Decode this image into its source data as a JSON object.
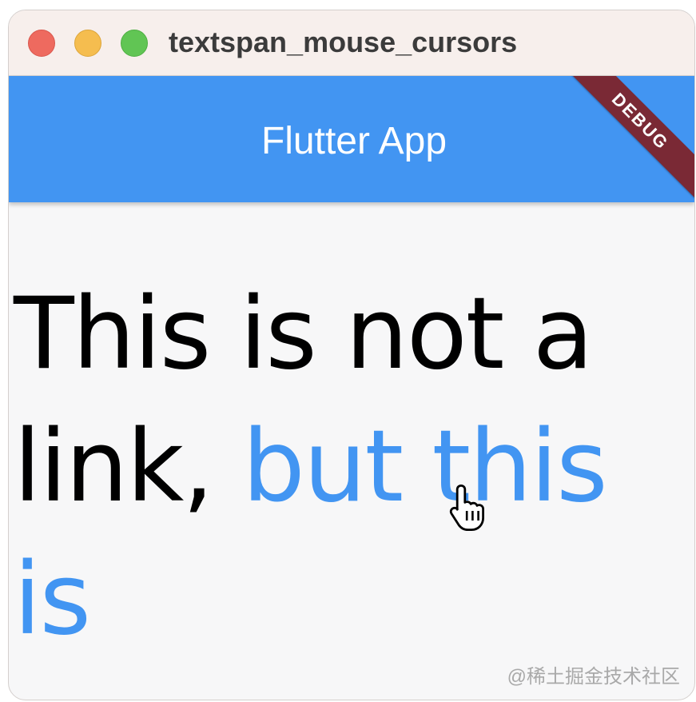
{
  "window": {
    "title": "textspan_mouse_cursors"
  },
  "appbar": {
    "title": "Flutter App",
    "debug_banner": "DEBUG"
  },
  "content": {
    "plain_text": "This is not a link, ",
    "link_text": "but this is"
  },
  "cursor": {
    "icon": "hand-pointer-icon"
  },
  "watermark": "@稀土掘金技术社区",
  "colors": {
    "appbar": "#4295f2",
    "link": "#4295f2",
    "debug_banner": "#7a2935",
    "close": "#ee6a5f",
    "minimize": "#f5bd4f",
    "maximize": "#61c554"
  }
}
